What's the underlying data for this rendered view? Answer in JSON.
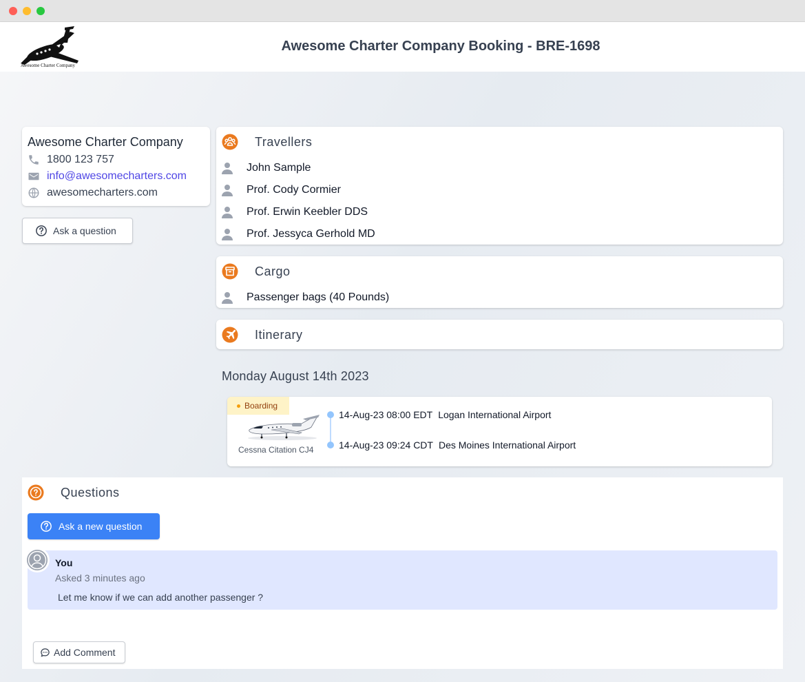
{
  "window": {
    "controls": [
      "close",
      "minimize",
      "maximize"
    ]
  },
  "header": {
    "logo_caption": "Awesome Charter Company",
    "title": "Awesome Charter Company Booking - BRE-1698"
  },
  "company": {
    "name": "Awesome Charter Company",
    "phone": "1800 123 757",
    "email": "info@awesomecharters.com",
    "website": "awesomecharters.com",
    "icons": {
      "phone": "phone-icon",
      "email": "mail-icon",
      "website": "globe-icon"
    }
  },
  "ask_question_button": {
    "label": "Ask a question",
    "icon": "question-circle-icon"
  },
  "travellers": {
    "title": "Travellers",
    "icon": "group-icon",
    "items": [
      {
        "name": "John Sample"
      },
      {
        "name": "Prof. Cody Cormier"
      },
      {
        "name": "Prof. Erwin Keebler DDS"
      },
      {
        "name": "Prof. Jessyca Gerhold MD"
      }
    ]
  },
  "cargo": {
    "title": "Cargo",
    "icon": "archive-box-icon",
    "items": [
      {
        "name": "Passenger bags (40 Pounds)"
      }
    ]
  },
  "itinerary": {
    "title": "Itinerary",
    "icon": "airplane-icon",
    "date": "Monday August 14th 2023",
    "flight": {
      "status": "Boarding",
      "aircraft": "Cessna Citation CJ4",
      "legs": [
        {
          "time": "14-Aug-23 08:00 EDT",
          "airport": "Logan International Airport"
        },
        {
          "time": "14-Aug-23 09:24 CDT",
          "airport": "Des Moines International Airport"
        }
      ]
    }
  },
  "questions": {
    "title": "Questions",
    "icon": "question-circle-icon",
    "ask_new_label": "Ask a new question",
    "items": [
      {
        "author": "You",
        "time": "Asked 3 minutes ago",
        "text": "Let me know if we can add another passenger ?"
      }
    ],
    "add_comment_label": "Add Comment"
  },
  "colors": {
    "accent_orange": "#ea7a1f",
    "primary_blue": "#3b82f6",
    "link": "#4f46e5",
    "question_bg": "#e0e7ff",
    "boarding_badge_bg": "#fef3c7"
  }
}
